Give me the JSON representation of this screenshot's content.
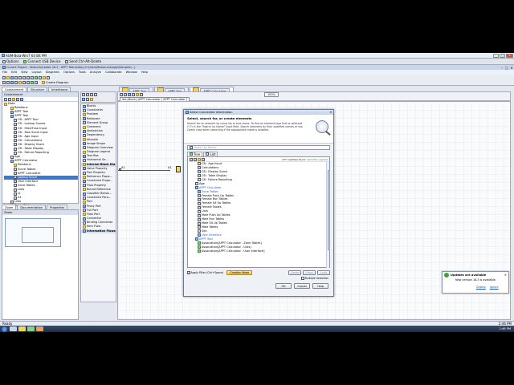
{
  "titlebar": {
    "text": "AGM-Bola-Win7 64 Bit PM"
  },
  "remote_bar": {
    "options": "Options",
    "usb": "Connect USB Device",
    "ctrl_alt_del": "Send Ctrl-Alt-Delete"
  },
  "app_title": "Current Project - Ventures/Ladies 18.2 - APPT Tool.mdzip [C:\\Users\\Resources\\agm\\Samples\\...]",
  "menu": [
    "File",
    "Edit",
    "View",
    "Layout",
    "Diagrams",
    "Options",
    "Tools",
    "Analyze",
    "Collaborate",
    "Window",
    "Help"
  ],
  "toolbar": {
    "create_diagram": "Create Diagram"
  },
  "left_tabs": [
    "Containment",
    "Structure",
    "Inheritance"
  ],
  "diagram_tabs": [
    "APPT Tool",
    "APPT Tool",
    "APPT Calculator"
  ],
  "containment_header": "Containment",
  "tree": [
    "Data",
    "Relations",
    "APPT Tool",
    "APPT Tool",
    "CB : APPT Tool",
    "CB : Lookup Scores",
    "CB : Hide/Fuse Input",
    "CB : Raw Score Input",
    "CB : Age Input",
    "CB : Calculations",
    "CB : Display Score",
    "CB : Table Display",
    "CB : Failure Reporting",
    "Age",
    "APPT Calculator",
    "Relations",
    "Score Tables",
    "APPT Calculator",
    "Lookup Score",
    "User Interface",
    "Zone Tables",
    "Lists",
    "Lt",
    "A1",
    "Lists",
    "Score Tables"
  ],
  "bottom_tabs": [
    "Zoom",
    "Documentation",
    "Properties"
  ],
  "zoom_panel_title": "Zoom",
  "palette_items": [
    "Blocks",
    "Constraints",
    "Problem",
    "Rationale",
    "Element Group",
    "Comment",
    "Abstraction",
    "Dependency",
    "Allocate",
    "Image Shape",
    "Diagram Overview",
    "Diagram Legend",
    "Text Box",
    "Horizontal Se...",
    "Internal Block Dia...",
    "Value Property",
    "Part Property",
    "Reference Prope...",
    "Constraint Prope...",
    "Flow Property",
    "Bound Reference",
    "Classifier Behav...",
    "Constraint Para...",
    "Port",
    "Proxy Port",
    "Full Port",
    "Flow Port",
    "Connector",
    "Binding Connector",
    "Item Flow",
    "Information Flows"
  ],
  "diagram_header": {
    "breadcrumb": "ibd [Block] APPT Calculator [ APPT Calculator ]",
    "zoom": "100%"
  },
  "canvas_labels": {
    "port_left": "A1",
    "port_mid": "A1"
  },
  "dialog": {
    "title": "Select Connected Information",
    "heading": "Select, search for, or create elements",
    "description": "Search for an element by using list or tree views. To find an element type text or wildcard (*,?) in the \"Search by Name\" input field. Search elements by their qualified names or use Camel case when searching if the appropriate mode is enabled.",
    "search_placeholder": "Search by Name",
    "tabs": [
      "Tree",
      "List"
    ],
    "found_text": "277 matches found",
    "filter_link": "edit filter applied",
    "list": [
      "CB : Age Input",
      "Calculations",
      "CB : Display Score",
      "CB : Table Display",
      "CB : Failure Reporting",
      "Age",
      "APPT Calculator",
      "Zone Tables",
      "Female Push Up Tables",
      "Female Run Tables",
      "Female Sit Up Tables",
      "Female Tables",
      "Lists",
      "Male Push Up Tables",
      "Male Run Tables",
      "Male Sit Up Tables",
      "Male Tables",
      "Sex",
      "User Interface",
      "APPT Tool",
      "Association[APPT Calculator - Zone Tables]",
      "Association[APPT Calculator - Lists]",
      "Association[APPT Calculator - User Interface]"
    ],
    "apply_filter": "Apply Filter (Ctrl+Space)",
    "creation_mode": "Creation Mode",
    "action_buttons": [
      "Create",
      "Clone",
      "Load"
    ],
    "multiple_selection": "Multiple Selection",
    "ok": "OK",
    "cancel": "Cancel",
    "help": "Help"
  },
  "notification": {
    "title": "Updates are available",
    "body": "New version 18.3 is available.",
    "details": "Details",
    "ignore": "Ignore"
  },
  "status": {
    "left": "Ready",
    "right": "2:46 PM"
  },
  "taskbar": {
    "time": "2:46 PM"
  }
}
